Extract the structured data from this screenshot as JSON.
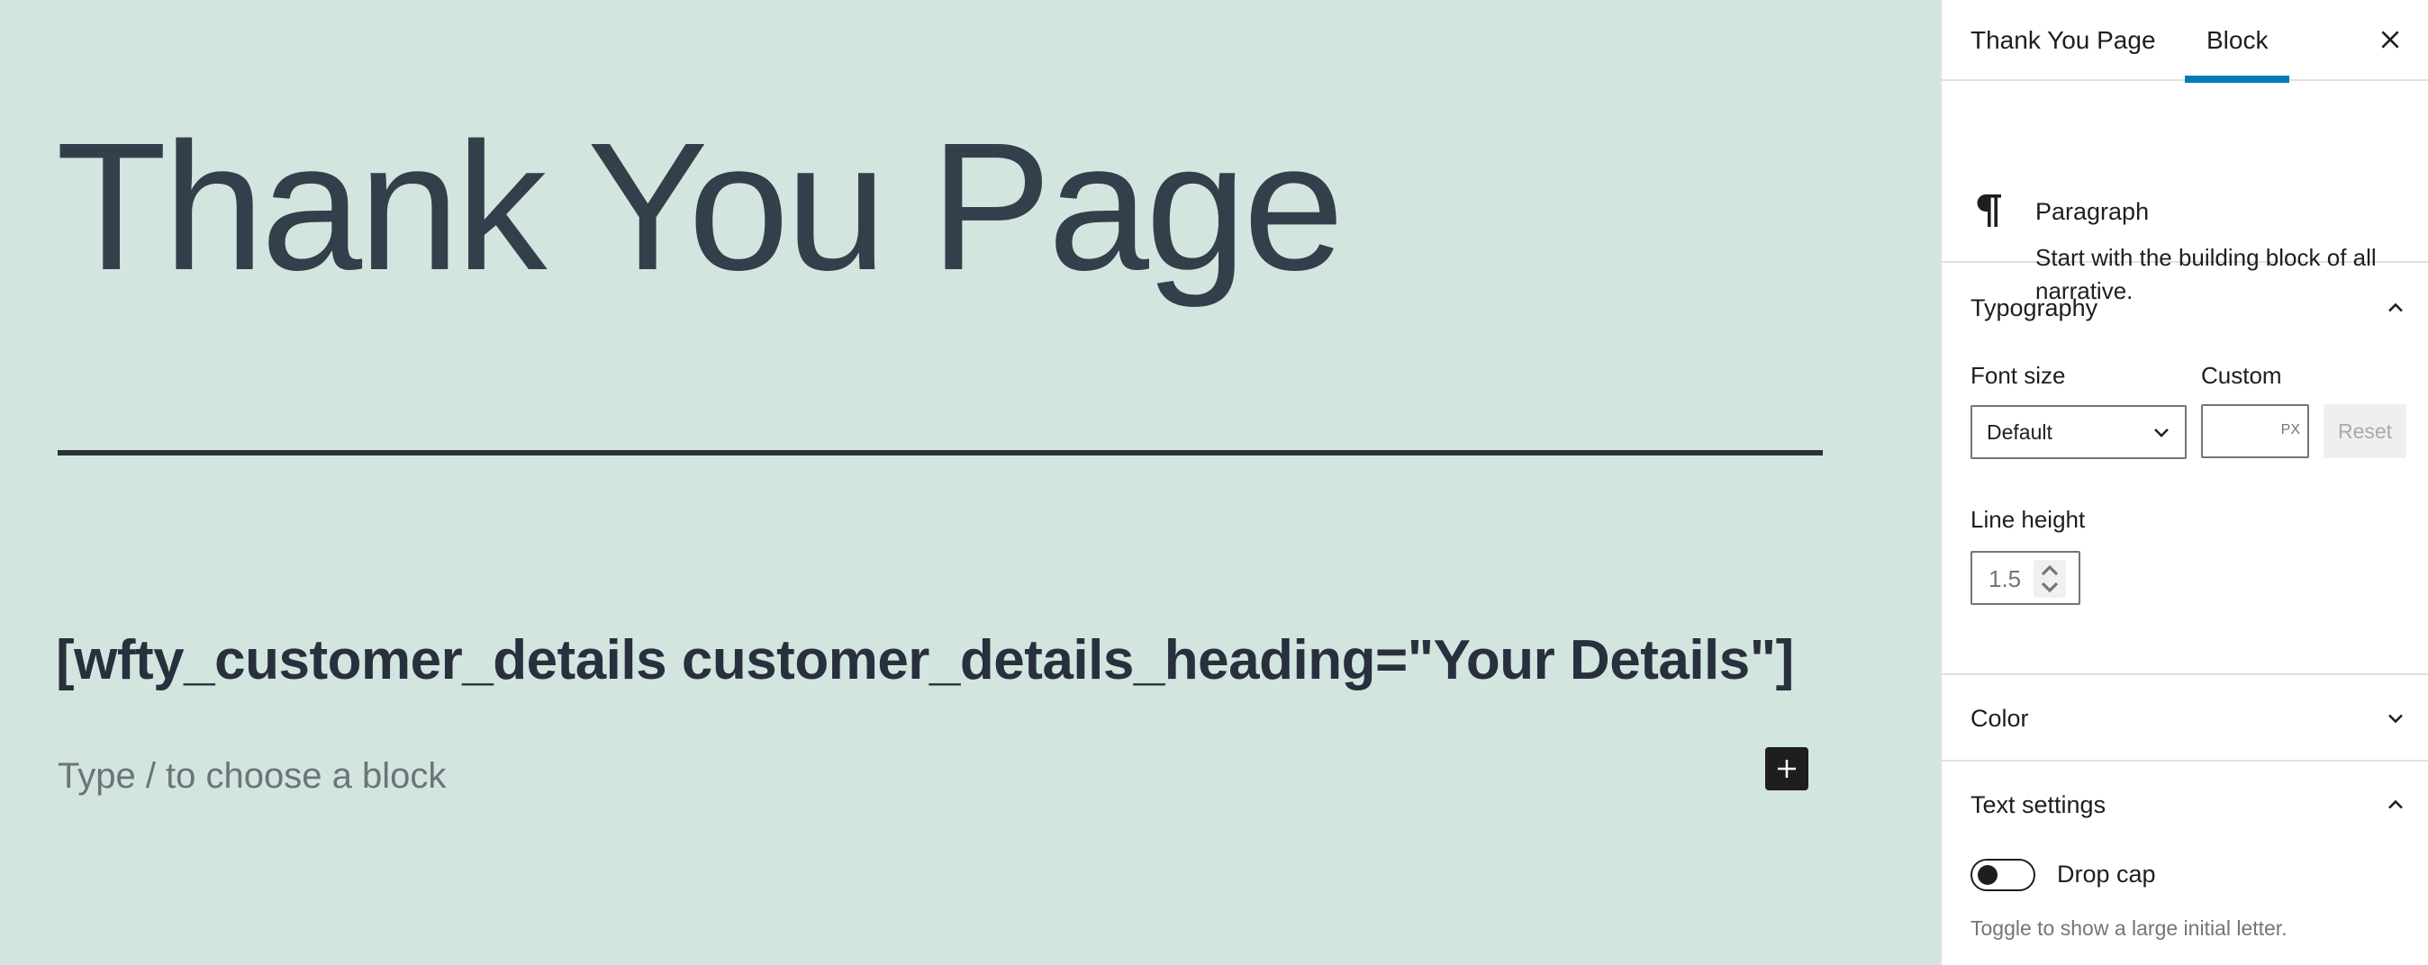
{
  "canvas": {
    "background": "#d2e5df",
    "page_title": "Thank You Page",
    "shortcode": "[wfty_customer_details customer_details_heading=\"Your Details\"]",
    "block_placeholder": "Type / to choose a block",
    "inserter_icon": "plus-icon"
  },
  "sidebar": {
    "tabs": [
      {
        "label": "Thank You Page",
        "active": false
      },
      {
        "label": "Block",
        "active": true
      }
    ],
    "close_icon": "close-icon",
    "accent_color": "#007cba",
    "block_card": {
      "icon": "paragraph-icon",
      "title": "Paragraph",
      "description": "Start with the building block of all narrative."
    },
    "typography": {
      "title": "Typography",
      "expanded": true,
      "font_size_label": "Font size",
      "font_size_value": "Default",
      "custom_label": "Custom",
      "custom_value": "",
      "custom_unit": "PX",
      "reset_label": "Reset",
      "line_height_label": "Line height",
      "line_height_placeholder": "1.5"
    },
    "color": {
      "title": "Color",
      "expanded": false
    },
    "text_settings": {
      "title": "Text settings",
      "expanded": true,
      "drop_cap_label": "Drop cap",
      "drop_cap_enabled": false,
      "drop_cap_help": "Toggle to show a large initial letter."
    }
  }
}
